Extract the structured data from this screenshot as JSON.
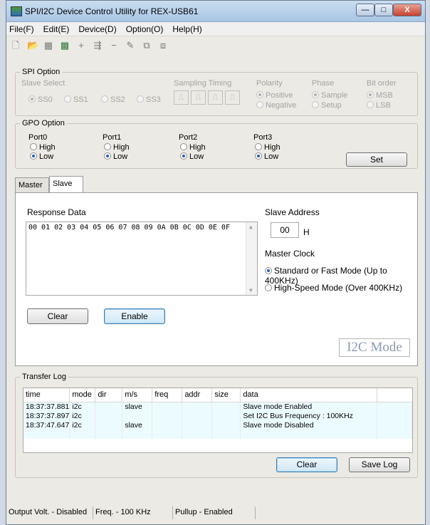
{
  "window": {
    "title": "SPI/I2C Device Control Utility for REX-USB61",
    "min_label": "—",
    "max_label": "□",
    "close_label": "X"
  },
  "menu": [
    "File(F)",
    "Edit(E)",
    "Device(D)",
    "Option(O)",
    "Help(H)"
  ],
  "toolbar": {
    "icons": [
      "new-icon",
      "open-icon",
      "save-icon",
      "device-icon",
      "add-icon",
      "insert-icon",
      "remove-icon",
      "edit-icon",
      "copy-icon",
      "paste-icon"
    ],
    "glyphs": [
      "🗋",
      "📂",
      "▦",
      "▩",
      "+",
      "⇶",
      "−",
      "✎",
      "⧉",
      "⧈"
    ]
  },
  "spi": {
    "label": "SPI Option",
    "slave_select": {
      "label": "Slave Select",
      "options": [
        "SS0",
        "SS1",
        "SS2",
        "SS3"
      ],
      "selected": "SS0"
    },
    "sampling": {
      "label": "Sampling Timing",
      "glyphs": [
        "⎍",
        "⎍",
        "⎍",
        "⎍"
      ]
    },
    "polarity": {
      "label": "Polarity",
      "options": [
        "Positive",
        "Negative"
      ],
      "selected": "Positive"
    },
    "phase": {
      "label": "Phase",
      "options": [
        "Sample",
        "Setup"
      ],
      "selected": "Sample"
    },
    "bitorder": {
      "label": "Bit order",
      "options": [
        "MSB",
        "LSB"
      ],
      "selected": "MSB"
    }
  },
  "gpo": {
    "label": "GPO Option",
    "ports": [
      {
        "name": "Port0",
        "high": "High",
        "low": "Low",
        "selected": "Low"
      },
      {
        "name": "Port1",
        "high": "High",
        "low": "Low",
        "selected": "Low"
      },
      {
        "name": "Port2",
        "high": "High",
        "low": "Low",
        "selected": "Low"
      },
      {
        "name": "Port3",
        "high": "High",
        "low": "Low",
        "selected": "Low"
      }
    ],
    "set_label": "Set"
  },
  "tabs": [
    "Master",
    "Slave"
  ],
  "active_tab": "Slave",
  "slave": {
    "response_label": "Response Data",
    "response_data": "00 01 02 03 04 05 06 07 08 09 0A 0B 0C 0D 0E 0F",
    "address_label": "Slave Address",
    "address": "00",
    "address_suffix": "H",
    "clock_label": "Master Clock",
    "clock_options": [
      "Standard or Fast Mode (Up to 400KHz)",
      "High-Speed Mode (Over 400KHz)"
    ],
    "clock_selected": "Standard or Fast Mode (Up to 400KHz)",
    "clear_label": "Clear",
    "enable_label": "Enable",
    "mode_badge": "I2C Mode"
  },
  "log": {
    "label": "Transfer Log",
    "columns": [
      "time",
      "mode",
      "dir",
      "m/s",
      "freq",
      "addr",
      "size",
      "data"
    ],
    "rows": [
      [
        "18:37:37.881",
        "i2c",
        "",
        "slave",
        "",
        "",
        "",
        "Slave mode Enabled"
      ],
      [
        "18:37:37.897",
        "i2c",
        "",
        "",
        "",
        "",
        "",
        "Set I2C Bus Frequency : 100KHz"
      ],
      [
        "18:37:47.647",
        "i2c",
        "",
        "slave",
        "",
        "",
        "",
        "Slave mode Disabled"
      ]
    ],
    "clear_label": "Clear",
    "save_label": "Save Log"
  },
  "status": [
    "Output Volt. - Disabled",
    "Freq. - 100 KHz",
    "Pullup - Enabled"
  ]
}
